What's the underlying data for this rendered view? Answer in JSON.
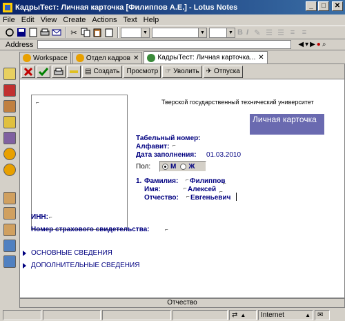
{
  "window": {
    "title": "КадрыТест: Личная карточка [Филиппов А.Е.] - Lotus Notes",
    "controls": {
      "minimize": "_",
      "maximize": "□",
      "close": "✕"
    }
  },
  "menu": [
    "File",
    "Edit",
    "View",
    "Create",
    "Actions",
    "Text",
    "Help"
  ],
  "toolbar": {
    "format_bold": "B",
    "format_italic": "I"
  },
  "address": {
    "label": "Address",
    "value": ""
  },
  "tabs": [
    {
      "label": "Workspace",
      "icon_color": "#e8a000",
      "active": false
    },
    {
      "label": "Отдел кадров",
      "icon_color": "#e8a000",
      "active": false
    },
    {
      "label": "КадрыТест: Личная карточка...",
      "icon_color": "#3a8a3a",
      "active": true
    }
  ],
  "actions": {
    "create": "Создать",
    "view": "Просмотр",
    "dismiss": "Уволить",
    "vacation": "Отпуска"
  },
  "form": {
    "university": "Тверской государственный технический университет",
    "card_title": "Личная карточка",
    "tab_number_label": "Табельный номер:",
    "alphabet_label": "Алфавит:",
    "fill_date_label": "Дата заполнения:",
    "fill_date_value": "01.03.2010",
    "gender_label": "Пол:",
    "gender_m": "М",
    "gender_f": "Ж",
    "gender_selected": "М",
    "num": "1.",
    "surname_label": "Фамилия:",
    "surname_value": "Филиппов",
    "name_label": "Имя:",
    "name_value": "Алексей",
    "patronymic_label": "Отчество:",
    "patronymic_value": "Евгеньевич",
    "inn_label": "ИНН:",
    "insurance_label": "Номер страхового свидетельства:",
    "section_main": "ОСНОВНЫЕ СВЕДЕНИЯ",
    "section_extra": "ДОПОЛНИТЕЛЬНЫЕ СВЕДЕНИЯ"
  },
  "status": {
    "field_hint": "Отчество",
    "zone": "Internet"
  }
}
